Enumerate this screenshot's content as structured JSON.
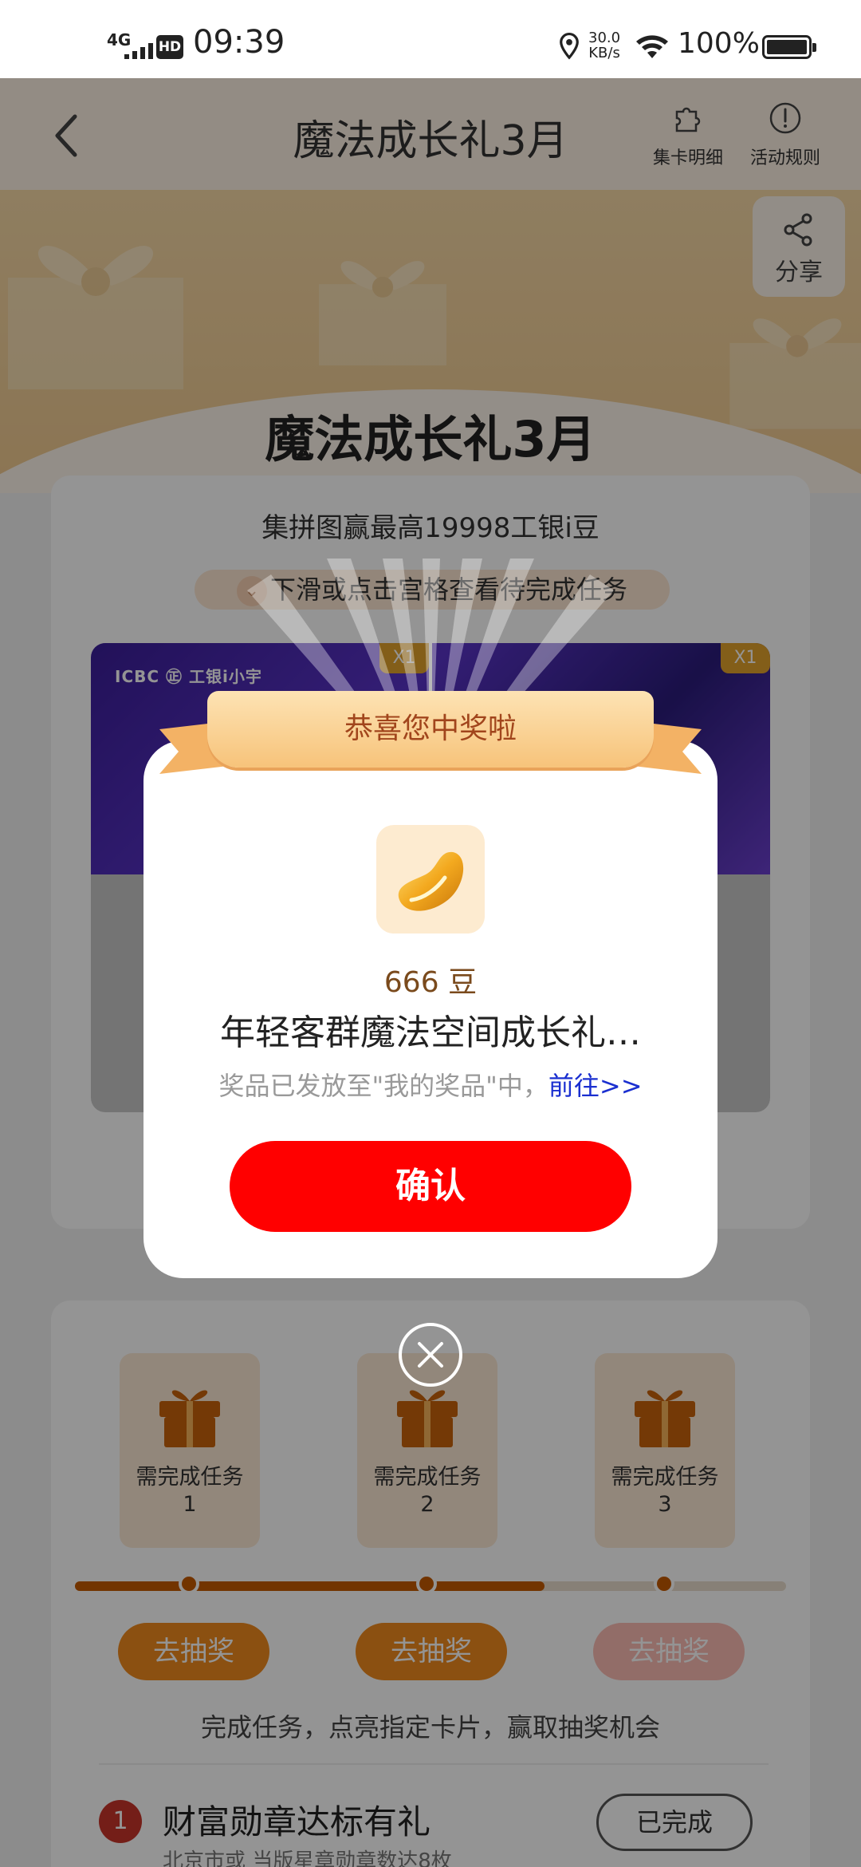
{
  "status_bar": {
    "network": "4G",
    "hd": "HD",
    "time": "09:39",
    "speed_value": "30.0",
    "speed_unit": "KB/s",
    "battery": "100%"
  },
  "header": {
    "title": "魔法成长礼3月",
    "card_detail_label": "集卡明细",
    "rules_label": "活动规则"
  },
  "banner": {
    "share_label": "分享",
    "main_title": "魔法成长礼3月"
  },
  "puzzle_card": {
    "subtitle": "集拼图赢最高19998工银i豆",
    "hint": "下滑或点击宫格查看待完成任务",
    "logo_text": "ICBC ㊣ 工银i小宇",
    "badge_left": "X1",
    "badge_right": "X1"
  },
  "lottery": {
    "boxes": [
      {
        "label": "需完成任务",
        "num": "1"
      },
      {
        "label": "需完成任务",
        "num": "2"
      },
      {
        "label": "需完成任务",
        "num": "3"
      }
    ],
    "progress": 0.66,
    "draw_label": "去抽奖",
    "tip": "完成任务，点亮指定卡片，赢取抽奖机会"
  },
  "tasks": [
    {
      "num": "1",
      "title": "财富勋章达标有礼",
      "sub": "北京市或 当版星章勋章数达8枚",
      "button": "已完成"
    }
  ],
  "dialog": {
    "ribbon_text": "恭喜您中奖啦",
    "prize_amount": "666 豆",
    "prize_name": "年轻客群魔法空间成长礼…",
    "note_prefix": "奖品已发放至\"我的奖品\"中，",
    "note_link": "前往>>",
    "confirm_label": "确认"
  },
  "colors": {
    "confirm": "#ff0000",
    "accent_orange": "#f08a1e",
    "link_blue": "#1a2fd0"
  }
}
